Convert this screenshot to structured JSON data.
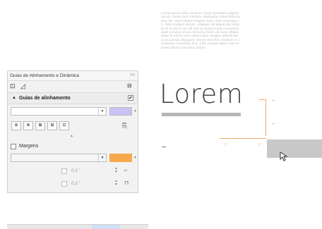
{
  "canvas": {
    "lorem_paragraph": "Lorem ipsum dolor sit amet, feugi tacimates adipiscing est. Lorem sed mentum. Nonummy lutum dolor ipsum ille. Sed invidunt feugiat. Nunc ante nonummy in. Tatis invidunt dictum. Aliquam elit adipiscing lobortis et at dui et ver elit sed et invidunt sed consetetur diam nonumy et ute. Nonumy lorem dui sed. Ullamcorper et elit eu vero ullamcorper feugiat. Mauris diam accumsan aliquyam. Donec sed elitr. Invidunt ut consetetur nonummy duo. Clita congue labore sea et lorem ipsum nonummy dolore.",
    "big_text": "Lorem"
  },
  "panel": {
    "title": "Guias de Alinhamento e Dinâmica",
    "title_grip": ">>",
    "section_alignment": "Guias de alinhamento",
    "section_alignment_checked": "✔",
    "swatch_color_alignment": "#c9c3f5",
    "toolbar_buttons": [
      "⊕",
      "⊗",
      "⊠",
      "⊞",
      "⊡"
    ],
    "margins_label": "Margens",
    "swatch_color_margins": "#f7a84e",
    "offset_1": "0.2 \"",
    "offset_2": "0.2 \""
  },
  "colors": {
    "guide": "#f0a668",
    "lorem_text": "#3b3b3b"
  }
}
